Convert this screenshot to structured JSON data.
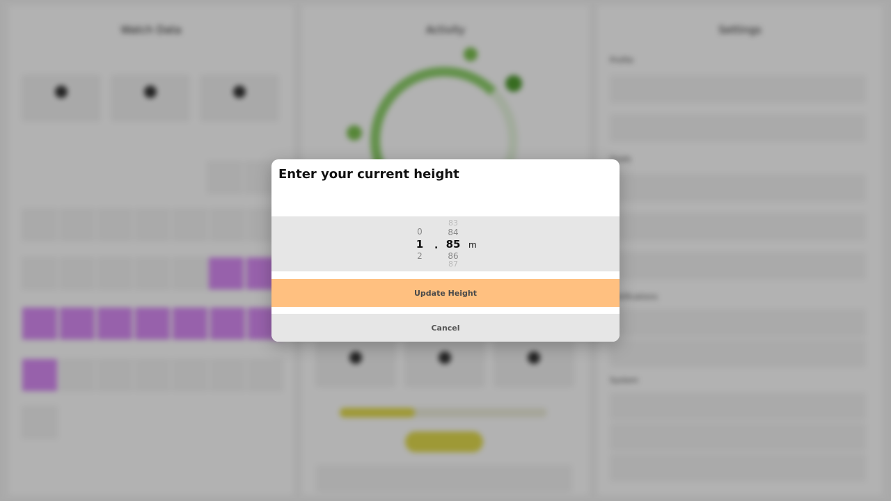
{
  "background": {
    "panel_titles": [
      "Watch Data",
      "Activity",
      "Settings"
    ],
    "settings_sections": [
      "Profile",
      "Goals",
      "Notifications",
      "System"
    ],
    "accent_colors": {
      "purple": "#d98cf5",
      "green": "#8ed06b",
      "yellow": "#e3dc4e",
      "orange": "#ffc080"
    }
  },
  "modal": {
    "title": "Enter your current height",
    "picker": {
      "integer_wheel": {
        "above": "0",
        "selected": "1",
        "below": "2"
      },
      "separator": ".",
      "decimal_wheel": {
        "above_far": "83",
        "above": "84",
        "selected": "85",
        "below": "86",
        "below_far": "87"
      },
      "unit": "m"
    },
    "update_button": "Update Height",
    "cancel_button": "Cancel"
  }
}
